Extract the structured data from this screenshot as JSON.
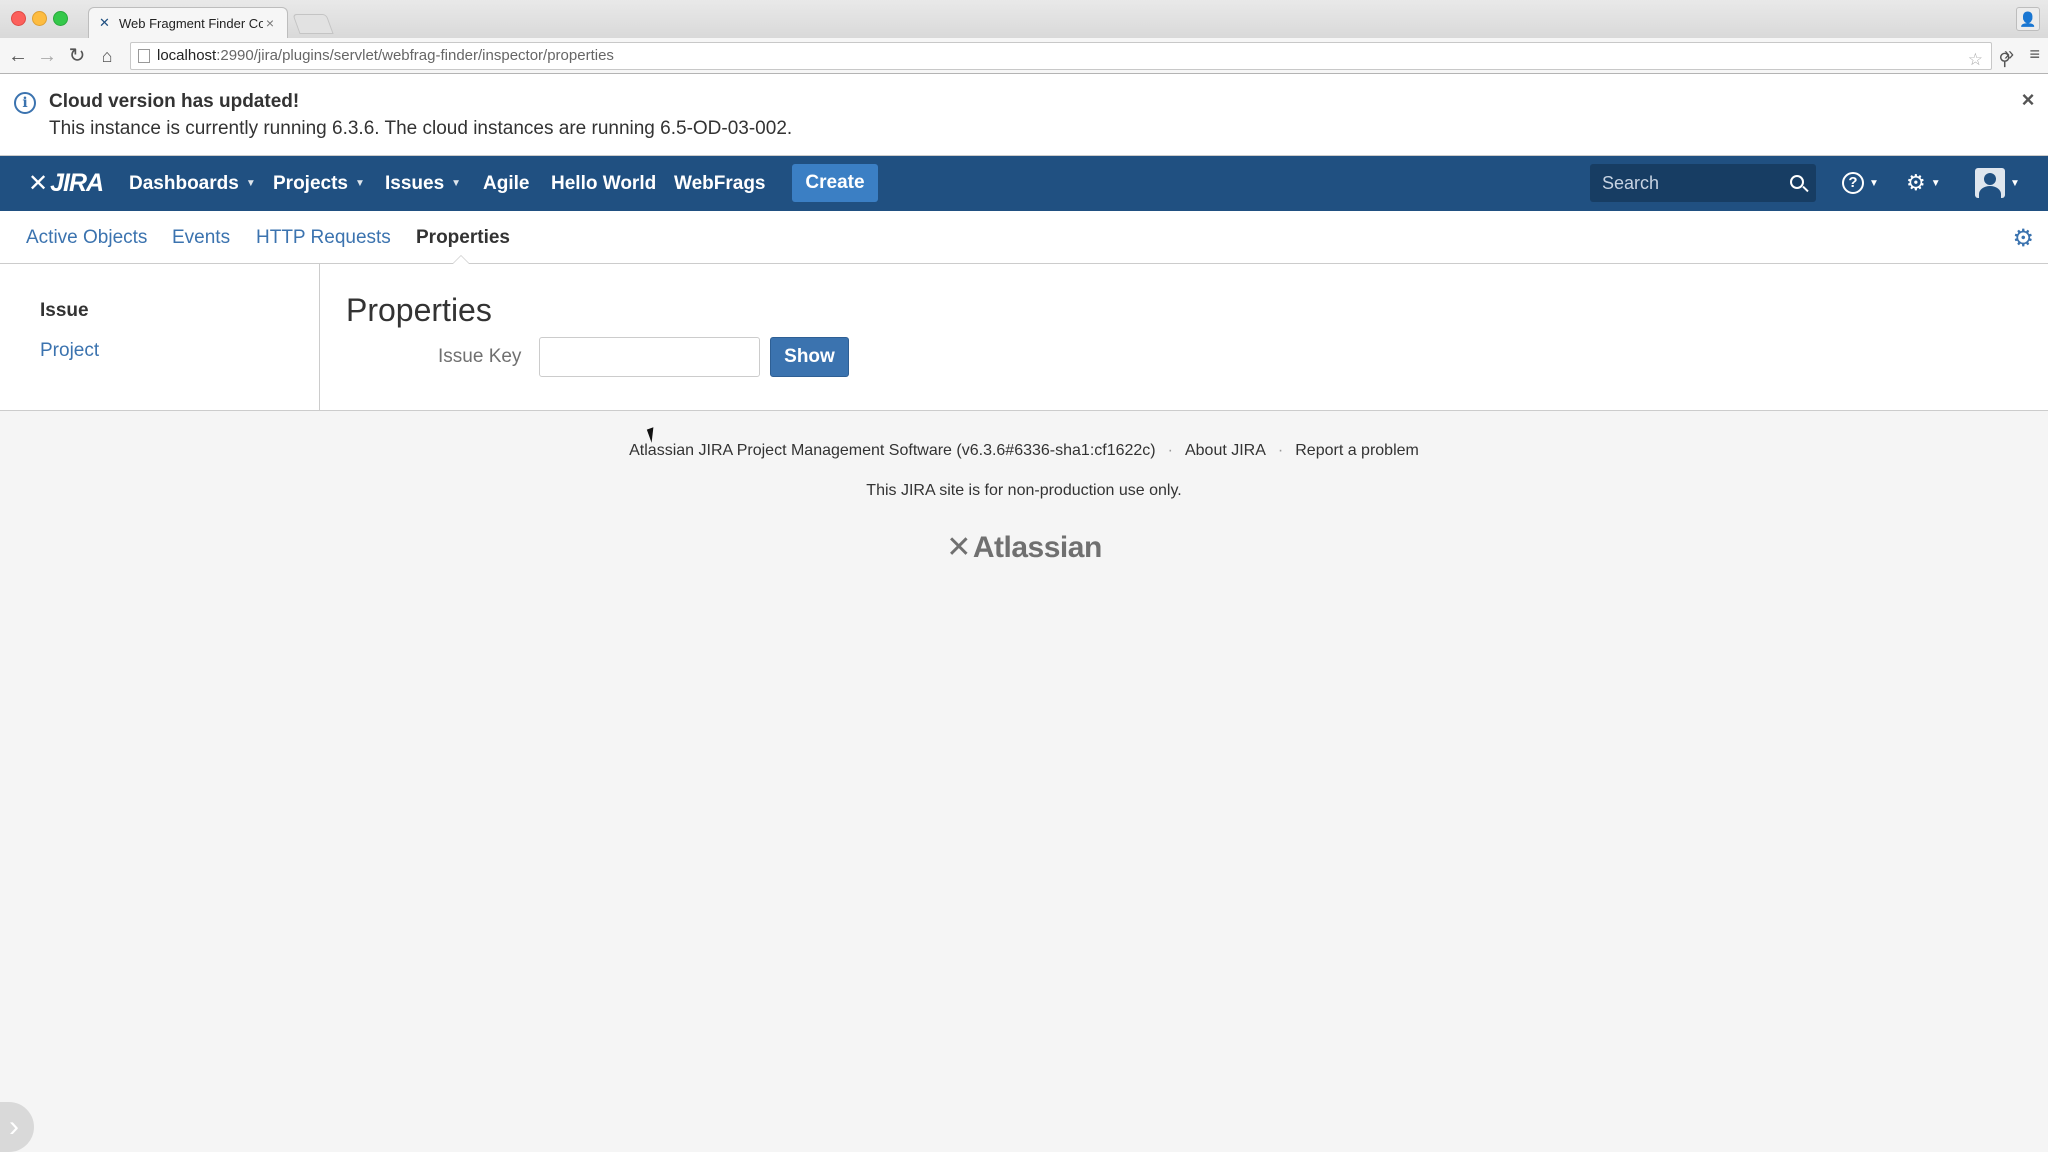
{
  "browser": {
    "tab_title": "Web Fragment Finder Con",
    "tab_close": "×",
    "url_host": "localhost",
    "url_rest": ":2990/jira/plugins/servlet/webfrag-finder/inspector/properties"
  },
  "flag": {
    "title": "Cloud version has updated!",
    "body": "This instance is currently running 6.3.6. The cloud instances are running 6.5-OD-03-002.",
    "close": "×"
  },
  "header": {
    "logo_text": "JIRA",
    "nav": {
      "dashboards": "Dashboards",
      "projects": "Projects",
      "issues": "Issues",
      "agile": "Agile",
      "hello_world": "Hello World",
      "webfrags": "WebFrags"
    },
    "create_label": "Create",
    "search_placeholder": "Search",
    "help_glyph": "?"
  },
  "subnav": {
    "active_objects": "Active Objects",
    "events": "Events",
    "http_requests": "HTTP Requests",
    "properties": "Properties"
  },
  "sidebar": {
    "heading": "Issue",
    "link": "Project"
  },
  "main": {
    "title": "Properties",
    "issue_key_label": "Issue Key",
    "issue_key_value": "",
    "show_label": "Show"
  },
  "footer": {
    "software": "Atlassian JIRA Project Management Software (v6.3.6#6336-sha1:cf1622c)",
    "about": "About JIRA",
    "report": "Report a problem",
    "notice": "This JIRA site is for non-production use only.",
    "logo_text": "Atlassian"
  },
  "colors": {
    "header_bg": "#205081",
    "link": "#3b73af",
    "create_bg": "#3b7fc4"
  }
}
